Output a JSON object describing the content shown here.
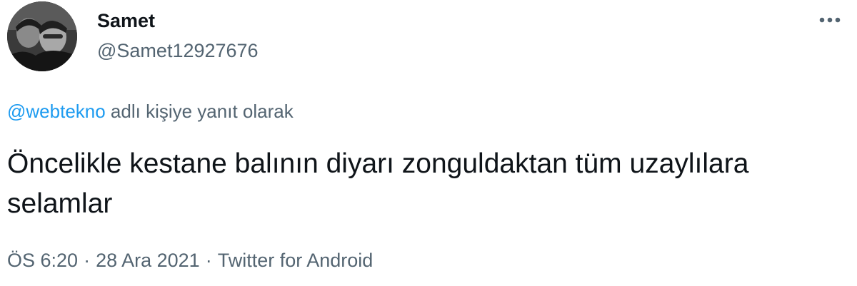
{
  "author": {
    "display_name": "Samet",
    "handle": "@Samet12927676"
  },
  "reply": {
    "mention": "@webtekno",
    "suffix": " adlı kişiye yanıt olarak"
  },
  "tweet": {
    "text": "Öncelikle kestane balının diyarı zonguldaktan tüm uzaylılara selamlar"
  },
  "meta": {
    "time": "ÖS 6:20",
    "separator": "·",
    "date": "28 Ara 2021",
    "source": "Twitter for Android"
  },
  "icons": {
    "more": "more-horizontal-icon",
    "avatar": "profile-avatar"
  },
  "colors": {
    "link": "#1d9bf0",
    "secondary_text": "#536471",
    "primary_text": "#0f1419"
  }
}
